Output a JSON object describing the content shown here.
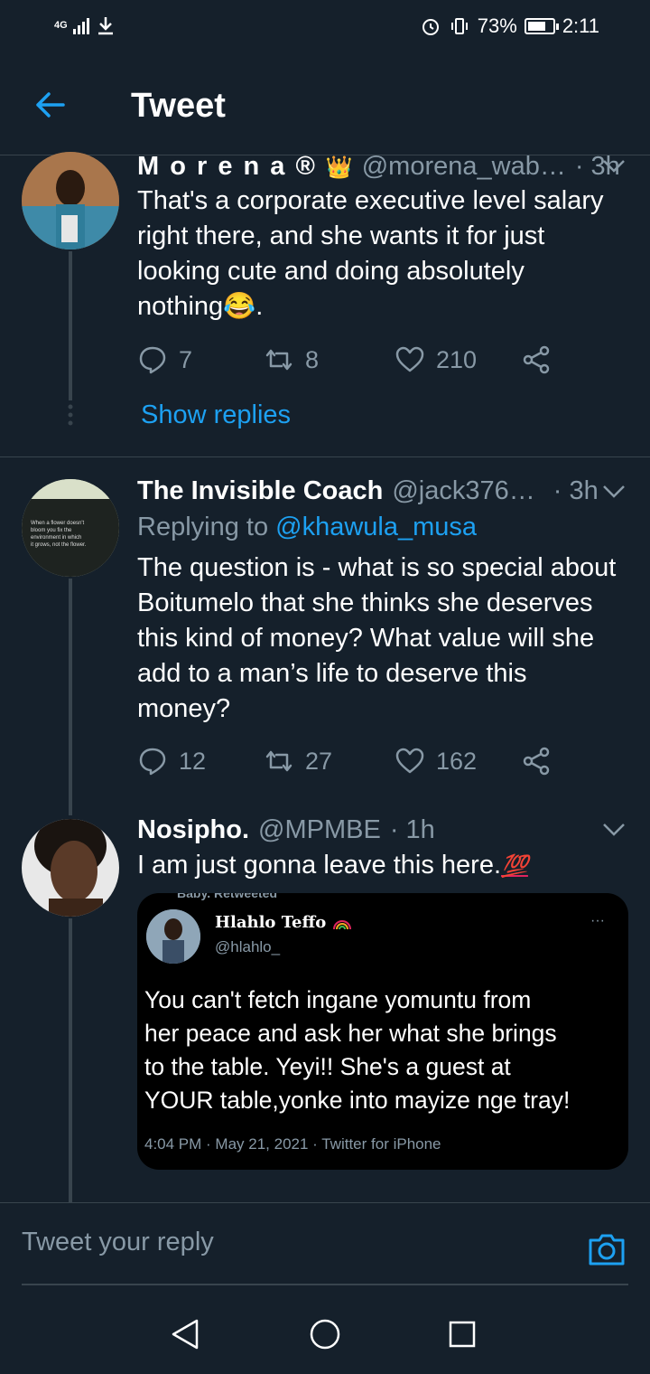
{
  "status_bar": {
    "network": "4G",
    "battery": "73%",
    "battery_level": 0.73,
    "time": "2:11"
  },
  "header": {
    "title": "Tweet",
    "back_icon": "arrow-left-icon"
  },
  "tweets": [
    {
      "name": "M o r e n a ®",
      "name_emoji": "👑",
      "handle": "@morena_wab…",
      "time": "· 3h",
      "lines": [
        "That's a corporate executive level salary",
        "right there, and she wants it for just",
        "looking cute and doing absolutely",
        "nothing😂."
      ],
      "replies": "7",
      "retweets": "8",
      "likes": "210",
      "show_replies": "Show replies"
    },
    {
      "name": "The Invisible Coach",
      "handle": "@jack376…",
      "time": "· 3h",
      "replying_prefix": "Replying to",
      "replying_to": "@khawula_musa",
      "lines": [
        "The question is - what is so special about",
        "Boitumelo that she thinks she deserves",
        "this kind of money?  What value will she",
        "add to a man’s life to deserve this",
        "money?"
      ],
      "avatar_text": [
        "When a flower doesn't",
        "bloom you fix the",
        "environment in which",
        "it grows, not the flower."
      ],
      "replies": "12",
      "retweets": "27",
      "likes": "162"
    },
    {
      "name": "Nosipho.",
      "handle": "@MPMBE",
      "time": "· 1h",
      "text": "I am just gonna leave this here.",
      "emoji": "💯",
      "embed": {
        "retweeted_by": "Baby. Retweeted",
        "name": "Hlahlo Teffo",
        "handle": "@hlahlo_",
        "more": "···",
        "lines": [
          "You can't fetch ingane yomuntu from",
          "her peace and ask her what she brings",
          "to the table. Yeyi!! She's a guest at",
          "YOUR table,yonke into mayize nge tray!"
        ],
        "meta": "4:04 PM · May 21, 2021 · Twitter for iPhone"
      }
    }
  ],
  "reply": {
    "placeholder": "Tweet your reply"
  },
  "icons": {
    "accent": "#1da1f2",
    "muted": "#8899a6",
    "background": "#15202b"
  }
}
